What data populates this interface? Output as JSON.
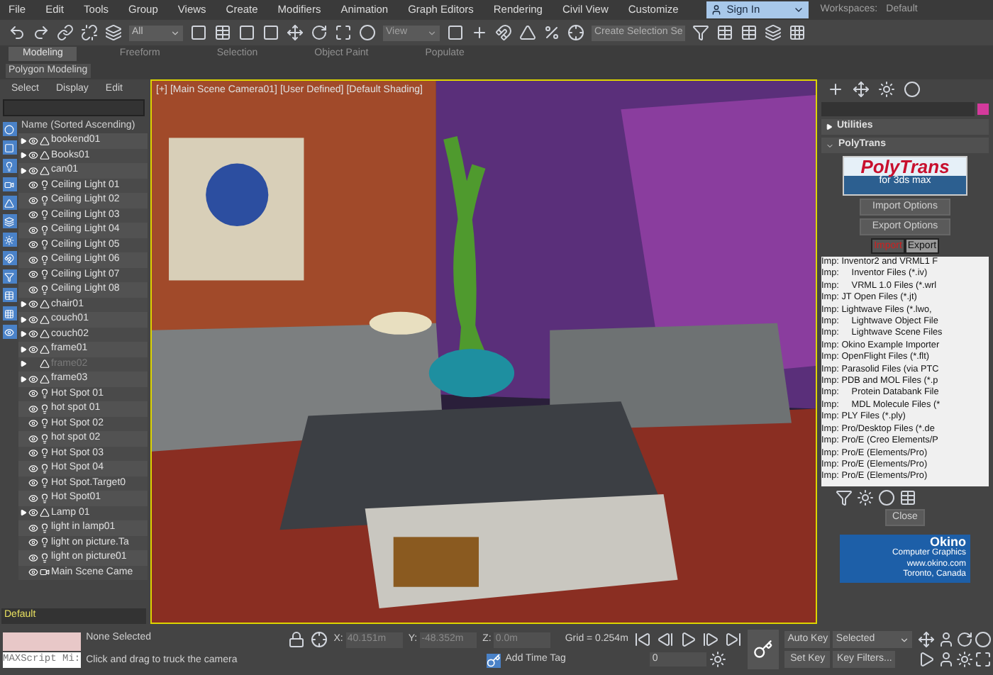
{
  "menu": [
    "File",
    "Edit",
    "Tools",
    "Group",
    "Views",
    "Create",
    "Modifiers",
    "Animation",
    "Graph Editors",
    "Rendering",
    "Civil View",
    "Customize"
  ],
  "account": {
    "sign_in": "Sign In",
    "workspace_label": "Workspaces:",
    "workspace": "Default"
  },
  "toolbar": {
    "selection_filter": "All",
    "reference": "View",
    "selection_set": "Create Selection Se"
  },
  "ribbon": {
    "tabs": [
      {
        "label": "Modeling",
        "selected": true
      },
      {
        "label": "Freeform",
        "selected": false
      },
      {
        "label": "Selection",
        "selected": false
      },
      {
        "label": "Object Paint",
        "selected": false
      },
      {
        "label": "Populate",
        "selected": false
      }
    ],
    "panel": "Polygon Modeling"
  },
  "explorer": {
    "menu": [
      "Select",
      "Display",
      "Edit"
    ],
    "column": "Name (Sorted Ascending)",
    "rows": [
      {
        "name": "bookend01",
        "kind": "geometry",
        "expandable": true,
        "visible": true
      },
      {
        "name": "Books01",
        "kind": "geometry",
        "expandable": true,
        "visible": true
      },
      {
        "name": "can01",
        "kind": "geometry",
        "expandable": true,
        "visible": true
      },
      {
        "name": "Ceiling Light 01",
        "kind": "light",
        "expandable": false,
        "visible": true
      },
      {
        "name": "Ceiling Light 02",
        "kind": "light",
        "expandable": false,
        "visible": true
      },
      {
        "name": "Ceiling Light 03",
        "kind": "light",
        "expandable": false,
        "visible": true
      },
      {
        "name": "Ceiling Light 04",
        "kind": "light",
        "expandable": false,
        "visible": true
      },
      {
        "name": "Ceiling Light 05",
        "kind": "light",
        "expandable": false,
        "visible": true
      },
      {
        "name": "Ceiling Light 06",
        "kind": "light",
        "expandable": false,
        "visible": true
      },
      {
        "name": "Ceiling Light 07",
        "kind": "light",
        "expandable": false,
        "visible": true
      },
      {
        "name": "Ceiling Light 08",
        "kind": "light",
        "expandable": false,
        "visible": true
      },
      {
        "name": "chair01",
        "kind": "geometry",
        "expandable": true,
        "visible": true
      },
      {
        "name": "couch01",
        "kind": "geometry",
        "expandable": true,
        "visible": true
      },
      {
        "name": "couch02",
        "kind": "geometry",
        "expandable": true,
        "visible": true
      },
      {
        "name": "frame01",
        "kind": "geometry",
        "expandable": true,
        "visible": true
      },
      {
        "name": "frame02",
        "kind": "geometry",
        "expandable": true,
        "visible": false
      },
      {
        "name": "frame03",
        "kind": "geometry",
        "expandable": true,
        "visible": true
      },
      {
        "name": "Hot Spot 01",
        "kind": "light",
        "expandable": false,
        "visible": true
      },
      {
        "name": "hot spot 01",
        "kind": "light",
        "expandable": false,
        "visible": true
      },
      {
        "name": "Hot Spot 02",
        "kind": "light",
        "expandable": false,
        "visible": true
      },
      {
        "name": "hot spot 02",
        "kind": "light",
        "expandable": false,
        "visible": true
      },
      {
        "name": "Hot Spot 03",
        "kind": "light",
        "expandable": false,
        "visible": true
      },
      {
        "name": "Hot Spot 04",
        "kind": "light",
        "expandable": false,
        "visible": true
      },
      {
        "name": "Hot Spot.Target0",
        "kind": "light",
        "expandable": false,
        "visible": true
      },
      {
        "name": "Hot Spot01",
        "kind": "light",
        "expandable": false,
        "visible": true
      },
      {
        "name": "Lamp 01",
        "kind": "geometry",
        "expandable": true,
        "visible": true
      },
      {
        "name": "light in lamp01",
        "kind": "light",
        "expandable": false,
        "visible": true
      },
      {
        "name": "light on picture.Ta",
        "kind": "light",
        "expandable": false,
        "visible": true
      },
      {
        "name": "light on picture01",
        "kind": "light",
        "expandable": false,
        "visible": true
      },
      {
        "name": "Main Scene Came",
        "kind": "camera",
        "expandable": false,
        "visible": true
      }
    ],
    "layer": "Default"
  },
  "viewport": {
    "labels": [
      "[+]",
      "[Main Scene Camera01]",
      "[User Defined]",
      "[Default Shading]"
    ]
  },
  "command_panel": {
    "rollouts": [
      {
        "title": "Utilities",
        "expanded": false
      },
      {
        "title": "PolyTrans",
        "expanded": true
      }
    ],
    "logo": {
      "title": "PolyTrans",
      "subtitle": "for 3ds max"
    },
    "buttons": [
      "Import Options",
      "Export Options"
    ],
    "tabs": [
      {
        "label": "Import",
        "selected": true
      },
      {
        "label": "Export",
        "selected": false
      }
    ],
    "formats": [
      "Imp: Inventor2 and VRML1 F",
      "Imp:     Inventor Files (*.iv)",
      "Imp:     VRML 1.0 Files (*.wrl",
      "Imp: JT Open Files (*.jt)",
      "Imp: Lightwave Files (*.lwo,",
      "Imp:     Lightwave Object File",
      "Imp:     Lightwave Scene Files",
      "Imp: Okino Example Importer",
      "Imp: OpenFlight Files (*.flt)",
      "Imp: Parasolid Files (via PTC",
      "Imp: PDB and MOL Files (*.p",
      "Imp:     Protein Databank File",
      "Imp:     MDL Molecule Files (*",
      "Imp: PLY Files (*.ply)",
      "Imp: Pro/Desktop Files (*.de",
      "Imp: Pro/E (Creo Elements/P",
      "Imp: Pro/E (Elements/Pro)",
      "Imp: Pro/E (Elements/Pro)",
      "Imp: Pro/E (Elements/Pro)"
    ],
    "close": "Close",
    "okino": [
      "Okino",
      "Computer Graphics",
      "www.okino.com",
      "Toronto, Canada"
    ]
  },
  "status": {
    "maxscript": "MAXScript Mi:",
    "selection": "None Selected",
    "prompt": "Click and drag to truck the camera",
    "coords": [
      {
        "axis": "X:",
        "value": "40.151m"
      },
      {
        "axis": "Y:",
        "value": "-48.352m"
      },
      {
        "axis": "Z:",
        "value": "0.0m"
      }
    ],
    "grid": "Grid = 0.254m",
    "time_tag": "Add Time Tag",
    "frame": "0",
    "auto_key": "Auto Key",
    "key_mode": "Selected",
    "set_key": "Set Key",
    "key_filters": "Key Filters..."
  }
}
